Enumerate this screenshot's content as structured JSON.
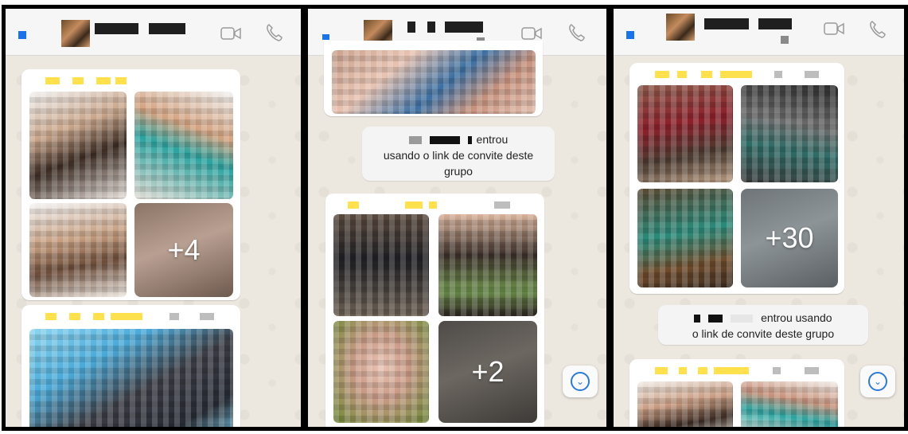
{
  "panels": [
    {
      "id": "left",
      "photo_group": {
        "more_count": "+4"
      }
    },
    {
      "id": "middle",
      "system_message": {
        "line1": "entrou",
        "line2": "usando o link de convite deste",
        "line3": "grupo"
      },
      "photo_group": {
        "more_count": "+2"
      }
    },
    {
      "id": "right",
      "photo_group": {
        "more_count": "+30"
      },
      "system_message": {
        "line1": "entrou usando",
        "line2": "o link de convite deste grupo"
      }
    }
  ],
  "icons": {
    "back": "back-icon",
    "video": "video-call-icon",
    "call": "phone-call-icon",
    "scroll_down": "chevron-down-icon"
  },
  "colors": {
    "chat_background": "#ece7df",
    "header_background": "#f6f6f6",
    "accent_blue": "#1a73e8",
    "sender_highlight": "#ffe14d",
    "panel_border": "#000000"
  }
}
